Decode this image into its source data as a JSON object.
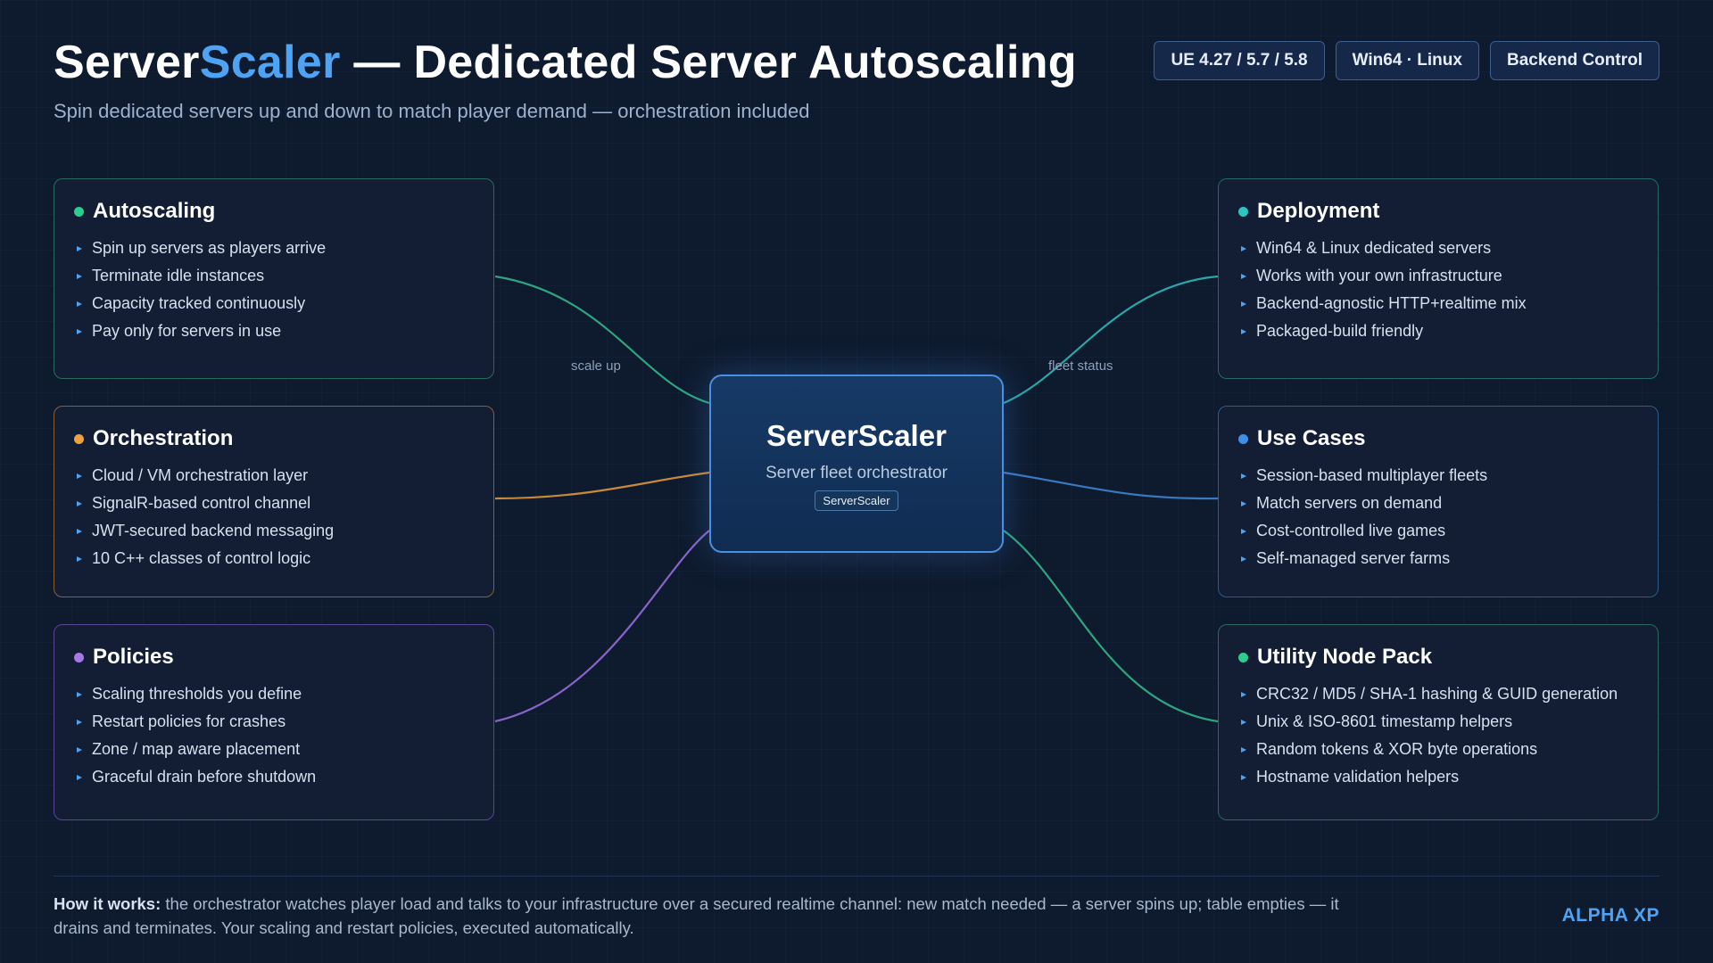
{
  "header": {
    "title_part1": "Server",
    "title_accent": "Scaler",
    "title_rest": " — Dedicated Server Autoscaling",
    "subtitle": "Spin dedicated servers up and down to match player demand — orchestration included",
    "badges": [
      "UE 4.27 / 5.7 / 5.8",
      "Win64 · Linux",
      "Backend Control"
    ]
  },
  "hub": {
    "title": "ServerScaler",
    "subtitle": "Server fleet orchestrator",
    "tag": "ServerScaler"
  },
  "edge_labels": {
    "autoscaling": "scale up",
    "deployment": "fleet status"
  },
  "cards": {
    "autoscaling": {
      "title": "Autoscaling",
      "color": "#2ecc8f",
      "items": [
        "Spin up servers as players arrive",
        "Terminate idle instances",
        "Capacity tracked continuously",
        "Pay only for servers in use"
      ]
    },
    "orchestration": {
      "title": "Orchestration",
      "color": "#f0a040",
      "items": [
        "Cloud / VM orchestration layer",
        "SignalR-based control channel",
        "JWT-secured backend messaging",
        "10 C++ classes of control logic"
      ]
    },
    "policies": {
      "title": "Policies",
      "color": "#a678e8",
      "items": [
        "Scaling thresholds you define",
        "Restart policies for crashes",
        "Zone / map aware placement",
        "Graceful drain before shutdown"
      ]
    },
    "deployment": {
      "title": "Deployment",
      "color": "#2ec4c4",
      "items": [
        "Win64 & Linux dedicated servers",
        "Works with your own infrastructure",
        "Backend-agnostic HTTP+realtime mix",
        "Packaged-build friendly"
      ]
    },
    "use_cases": {
      "title": "Use Cases",
      "color": "#3f8fe6",
      "items": [
        "Session-based multiplayer fleets",
        "Match servers on demand",
        "Cost-controlled live games",
        "Self-managed server farms"
      ]
    },
    "utility": {
      "title": "Utility Node Pack",
      "color": "#2ecc8f",
      "items": [
        "CRC32 / MD5 / SHA-1 hashing & GUID generation",
        "Unix & ISO-8601 timestamp helpers",
        "Random tokens & XOR byte operations",
        "Hostname validation helpers"
      ]
    }
  },
  "footer": {
    "lead": "How it works:",
    "text": " the orchestrator watches player load and talks to your infrastructure over a secured realtime channel: new match needed — a server spins up; table empties — it drains and terminates. Your scaling and restart policies, executed automatically.",
    "brand": "ALPHA XP"
  }
}
